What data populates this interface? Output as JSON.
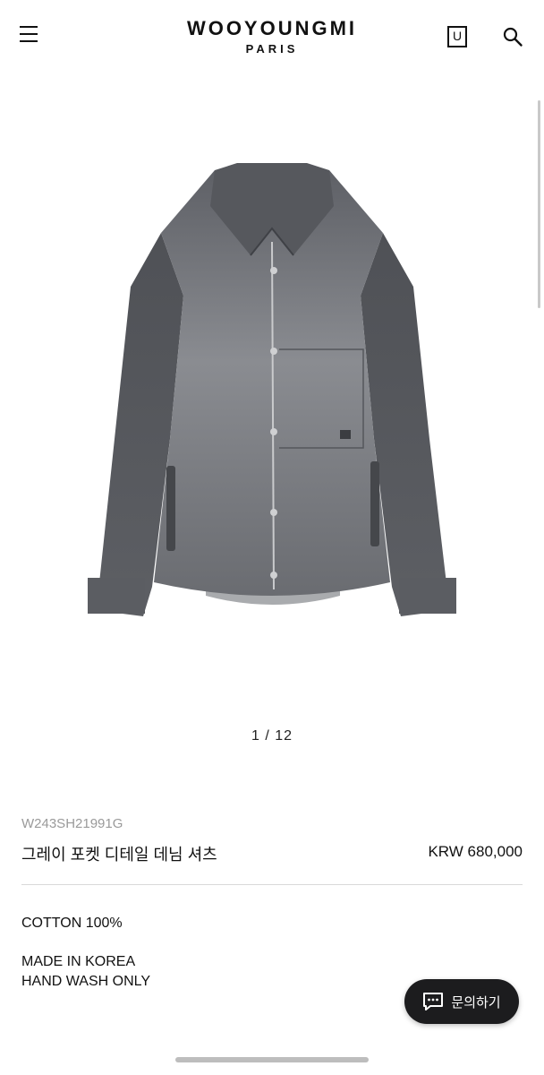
{
  "header": {
    "brand_main": "WOOYOUNGMI",
    "brand_sub": "PARIS",
    "menu_icon": "hamburger-icon",
    "account_icon_letter": "U",
    "search_icon": "search-icon"
  },
  "gallery": {
    "pager_text": "1 / 12",
    "image_subject": "gray denim shirt jacket"
  },
  "product": {
    "sku": "W243SH21991G",
    "name": "그레이 포켓 디테일 데님 셔츠",
    "price": "KRW 680,000"
  },
  "details": {
    "material": "COTTON 100%",
    "origin": "MADE IN KOREA",
    "care": "HAND WASH ONLY"
  },
  "inquiry_button": {
    "label": "문의하기",
    "icon": "chat-bubble-icon"
  },
  "colors": {
    "background": "#ffffff",
    "text": "#111111",
    "sku_gray": "#9a9a9a",
    "button_dark": "#1c1c1e"
  }
}
